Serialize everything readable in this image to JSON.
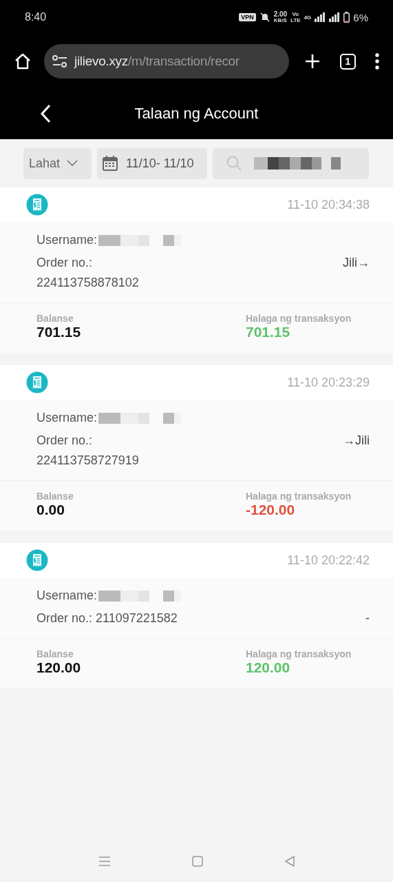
{
  "status_bar": {
    "time": "8:40",
    "vpn": "VPN",
    "speed": "2.00",
    "speed_unit": "KB/S",
    "volte_top": "Vo",
    "volte_bottom": "LTE",
    "network": "4G",
    "battery": "6%"
  },
  "browser": {
    "url_host": "jilievo.xyz",
    "url_path": "/m/transaction/recor",
    "tab_count": "1"
  },
  "header": {
    "title": "Talaan ng Account"
  },
  "filters": {
    "type": "Lahat",
    "date_range": "11/10- 11/10"
  },
  "transactions": [
    {
      "time": "11-10 20:34:38",
      "username_label": "Username:",
      "order_label": "Order no.:",
      "order_no": "224113758878102",
      "direction": "Jili→",
      "balance_label": "Balanse",
      "balance": "701.15",
      "amount_label": "Halaga ng transaksyon",
      "amount": "701.15",
      "color": "#5cc46a"
    },
    {
      "time": "11-10 20:23:29",
      "username_label": "Username:",
      "order_label": "Order no.:",
      "order_no": "224113758727919",
      "direction": "→Jili",
      "balance_label": "Balanse",
      "balance": "0.00",
      "amount_label": "Halaga ng transaksyon",
      "amount": "-120.00",
      "color": "#e0533d"
    },
    {
      "time": "11-10 20:22:42",
      "username_label": "Username:",
      "order_label": "Order no.:",
      "order_no": "211097221582",
      "direction": "-",
      "balance_label": "Balanse",
      "balance": "120.00",
      "amount_label": "Halaga ng transaksyon",
      "amount": "120.00",
      "color": "#5cc46a"
    }
  ]
}
